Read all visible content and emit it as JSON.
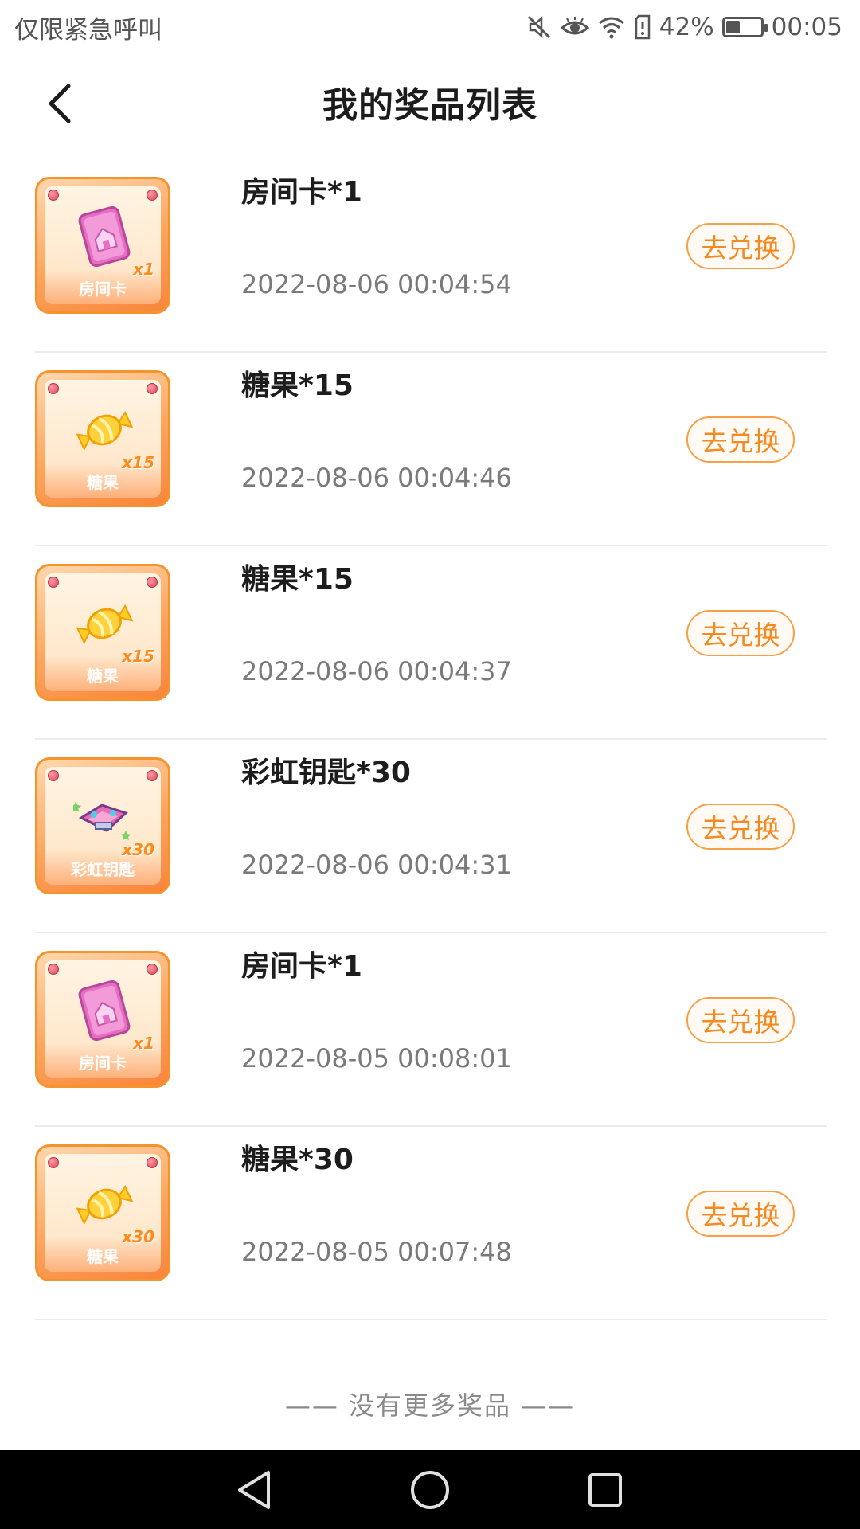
{
  "status_bar": {
    "carrier": "仅限紧急呼叫",
    "battery_percent": "42%",
    "battery_level": 0.42,
    "time": "00:05",
    "icons": [
      "mute-icon",
      "eye-comfort-icon",
      "wifi-icon",
      "sim-alert-icon",
      "battery-icon"
    ]
  },
  "header": {
    "title": "我的奖品列表",
    "back_icon": "chevron-left-icon"
  },
  "prizes": [
    {
      "name": "房间卡*1",
      "time": "2022-08-06 00:04:54",
      "button": "去兑换",
      "thumb_label": "房间卡",
      "thumb_qty": "x1",
      "icon": "room-card-icon"
    },
    {
      "name": "糖果*15",
      "time": "2022-08-06 00:04:46",
      "button": "去兑换",
      "thumb_label": "糖果",
      "thumb_qty": "x15",
      "icon": "candy-icon"
    },
    {
      "name": "糖果*15",
      "time": "2022-08-06 00:04:37",
      "button": "去兑换",
      "thumb_label": "糖果",
      "thumb_qty": "x15",
      "icon": "candy-icon"
    },
    {
      "name": "彩虹钥匙*30",
      "time": "2022-08-06 00:04:31",
      "button": "去兑换",
      "thumb_label": "彩虹钥匙",
      "thumb_qty": "x30",
      "icon": "rainbow-key-icon"
    },
    {
      "name": "房间卡*1",
      "time": "2022-08-05 00:08:01",
      "button": "去兑换",
      "thumb_label": "房间卡",
      "thumb_qty": "x1",
      "icon": "room-card-icon"
    },
    {
      "name": "糖果*30",
      "time": "2022-08-05 00:07:48",
      "button": "去兑换",
      "thumb_label": "糖果",
      "thumb_qty": "x30",
      "icon": "candy-icon"
    }
  ],
  "footer": {
    "no_more": "—— 没有更多奖品 ——"
  },
  "nav_bar": {
    "icons": [
      "back-triangle-icon",
      "home-circle-icon",
      "recents-square-icon"
    ]
  },
  "colors": {
    "accent": "#f6891f",
    "frame_orange": "#f6932d",
    "divider": "#ececec"
  }
}
